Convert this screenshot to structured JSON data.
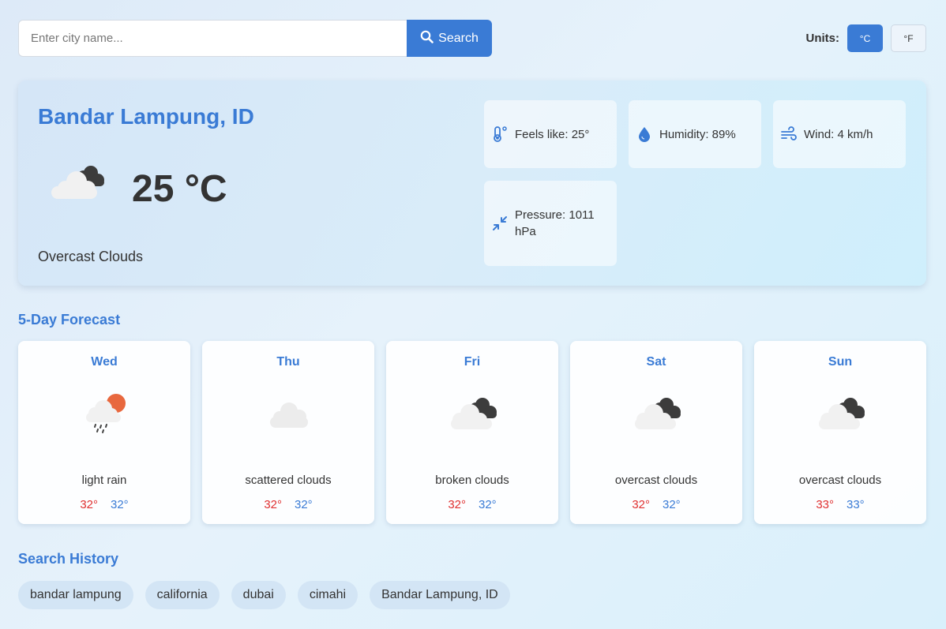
{
  "search": {
    "placeholder": "Enter city name...",
    "value": "",
    "button_label": "Search"
  },
  "units": {
    "label": "Units:",
    "celsius": "°C",
    "fahrenheit": "°F",
    "selected": "°C"
  },
  "current": {
    "city": "Bandar Lampung, ID",
    "temperature": "25 °C",
    "description": "Overcast Clouds",
    "icon": "broken-clouds-icon",
    "details": {
      "feels_like": "Feels like: 25°",
      "humidity": "Humidity: 89%",
      "wind": "Wind: 4 km/h",
      "pressure": "Pressure: 1011 hPa"
    }
  },
  "forecast": {
    "title": "5-Day Forecast",
    "days": [
      {
        "day": "Wed",
        "icon": "rain-sun-icon",
        "description": "light rain",
        "max": "32°",
        "min": "32°"
      },
      {
        "day": "Thu",
        "icon": "cloud-icon",
        "description": "scattered clouds",
        "max": "32°",
        "min": "32°"
      },
      {
        "day": "Fri",
        "icon": "broken-clouds-icon",
        "description": "broken clouds",
        "max": "32°",
        "min": "32°"
      },
      {
        "day": "Sat",
        "icon": "broken-clouds-icon",
        "description": "overcast clouds",
        "max": "32°",
        "min": "32°"
      },
      {
        "day": "Sun",
        "icon": "broken-clouds-icon",
        "description": "overcast clouds",
        "max": "33°",
        "min": "33°"
      }
    ]
  },
  "history": {
    "title": "Search History",
    "items": [
      "bandar lampung",
      "california",
      "dubai",
      "cimahi",
      "Bandar Lampung, ID"
    ]
  },
  "colors": {
    "accent": "#3a7bd5",
    "max_temp": "#e03131",
    "min_temp": "#3a7bd5"
  }
}
